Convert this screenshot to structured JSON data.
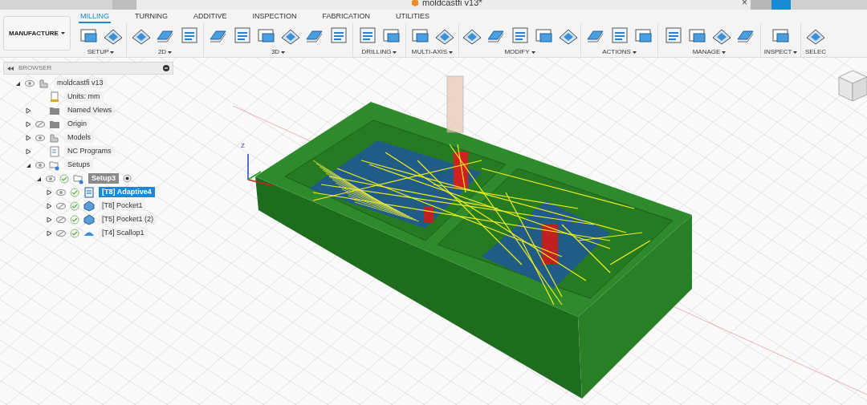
{
  "window": {
    "title": "moldcastfi v13*",
    "close": "×"
  },
  "tabs": [
    {
      "label": "MILLING",
      "selected": true
    },
    {
      "label": "TURNING",
      "selected": false
    },
    {
      "label": "ADDITIVE",
      "selected": false
    },
    {
      "label": "INSPECTION",
      "selected": false
    },
    {
      "label": "FABRICATION",
      "selected": false
    },
    {
      "label": "UTILITIES",
      "selected": false
    }
  ],
  "workspace": {
    "label": "MANUFACTURE"
  },
  "groups": [
    {
      "label": "SETUP"
    },
    {
      "label": "2D"
    },
    {
      "label": "3D"
    },
    {
      "label": "DRILLING"
    },
    {
      "label": "MULTI-AXIS"
    },
    {
      "label": "MODIFY"
    },
    {
      "label": "ACTIONS"
    },
    {
      "label": "MANAGE"
    },
    {
      "label": "INSPECT"
    },
    {
      "label": "SELEC"
    }
  ],
  "browser": {
    "title": "BROWSER",
    "items": [
      {
        "label": "moldcastfi v13",
        "kind": "document",
        "expanded": true,
        "visible": true,
        "children": [
          {
            "label": "Units: mm",
            "kind": "units"
          },
          {
            "label": "Named Views",
            "kind": "folder",
            "expanded": false
          },
          {
            "label": "Origin",
            "kind": "folder",
            "expanded": false,
            "visible": false
          },
          {
            "label": "Models",
            "kind": "component",
            "expanded": false,
            "visible": true
          },
          {
            "label": "NC Programs",
            "kind": "nc",
            "expanded": false
          },
          {
            "label": "Setups",
            "kind": "setups",
            "expanded": true,
            "visible": true,
            "children": [
              {
                "label": "Setup3",
                "kind": "setup",
                "expanded": true,
                "visible": true,
                "checked": true,
                "active": true,
                "children": [
                  {
                    "label": "[T8] Adaptive4",
                    "kind": "adaptive",
                    "expanded": false,
                    "visible": true,
                    "checked": true,
                    "selected": true
                  },
                  {
                    "label": "[T8] Pocket1",
                    "kind": "pocket",
                    "expanded": false,
                    "visible": false,
                    "checked": true,
                    "selected": false
                  },
                  {
                    "label": "[T5] Pocket1 (2)",
                    "kind": "pocket",
                    "expanded": false,
                    "visible": false,
                    "checked": true,
                    "selected": false
                  },
                  {
                    "label": "[T4] Scallop1",
                    "kind": "scallop",
                    "expanded": false,
                    "visible": false,
                    "checked": true,
                    "selected": false
                  }
                ]
              }
            ]
          }
        ]
      }
    ]
  },
  "viewport": {
    "axis": "Z"
  }
}
